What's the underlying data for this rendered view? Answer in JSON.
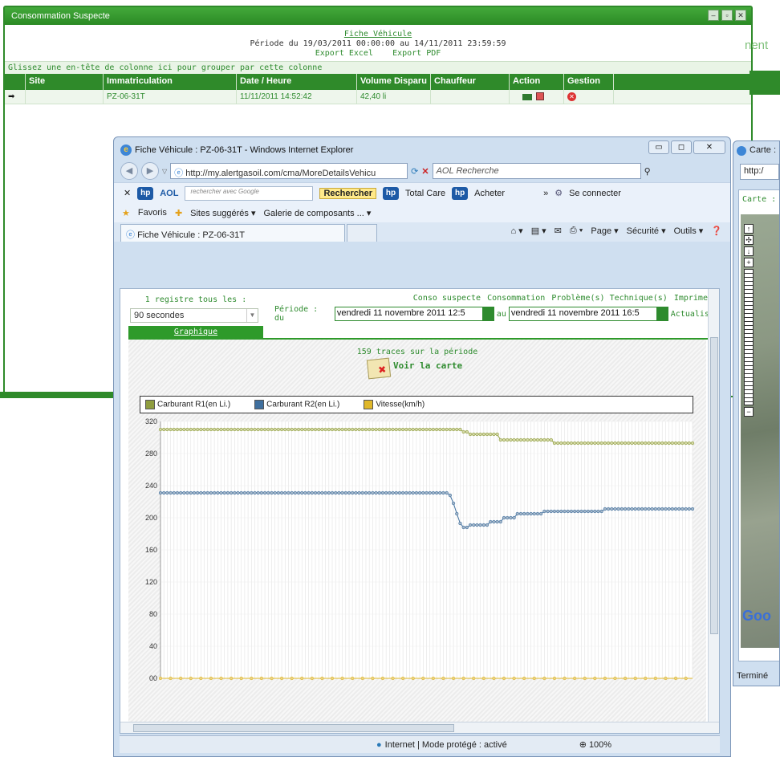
{
  "back_window": {
    "title": "Consommation Suspecte",
    "fiche_link": "Fiche Véhicule",
    "periode_text": "Période du 19/03/2011 00:00:00 au 14/11/2011 23:59:59",
    "export_excel": "Export Excel",
    "export_pdf": "Export PDF",
    "group_hint": "Glissez une en-tête de colonne ici pour grouper par cette colonne",
    "right_fragment": "nent",
    "columns": [
      "Site",
      "Immatriculation",
      "Date / Heure",
      "Volume Disparu",
      "Chauffeur",
      "Action",
      "Gestion"
    ],
    "row": {
      "marker": "➡",
      "site": "",
      "immatriculation": "PZ-06-31T",
      "date_heure": "11/11/2011 14:52:42",
      "volume": "42,40 li",
      "chauffeur": ""
    }
  },
  "ie_window": {
    "title": "Fiche Véhicule : PZ-06-31T - Windows Internet Explorer",
    "address": "http://my.alertgasoil.com/cma/MoreDetailsVehicu",
    "search_placeholder": "AOL Recherche",
    "toolbar": {
      "aol": "AOL",
      "search_with": "rechercher avec Google",
      "rechercher": "Rechercher",
      "total_care": "Total Care",
      "acheter": "Acheter",
      "se_connecter": "Se connecter"
    },
    "favorites": {
      "favoris": "Favoris",
      "sites": "Sites suggérés ▾",
      "galerie": "Galerie de composants ... ▾"
    },
    "tab_label": "Fiche Véhicule : PZ-06-31T",
    "cmd": {
      "page": "Page ▾",
      "securite": "Sécurité ▾",
      "outils": "Outils ▾"
    },
    "status_text": "Internet | Mode protégé : activé",
    "zoom": "100%"
  },
  "content": {
    "menu": [
      "Conso suspecte",
      "Consommation",
      "Problème(s) Technique(s)",
      "Imprimer"
    ],
    "registre_label": "1 registre tous les :",
    "registre_value": "90 secondes",
    "periode_label": "Période : du",
    "date_from": "vendredi 11 novembre 2011 12:5",
    "au": "au",
    "date_to": "vendredi 11 novembre 2011 16:5",
    "actualiser": "Actualiser",
    "graph_tab": "Graphique",
    "traces": "159 traces sur la période",
    "voir_carte": "Voir la carte"
  },
  "map_window": {
    "title": "Carte :",
    "address": "http:/",
    "carte_label": "Carte :",
    "google": "Goo",
    "status": "Terminé"
  },
  "colors": {
    "r1": "#8f9d3f",
    "r2": "#3f6f9e",
    "speed": "#e0b82a",
    "accent_green": "#2e8b2e"
  },
  "chart_data": {
    "type": "line",
    "ylim": [
      0,
      320
    ],
    "yticks": [
      "320",
      "280",
      "240",
      "200",
      "160",
      "120",
      "80",
      "40",
      "00"
    ],
    "legend": [
      "Carburant R1(en Li.)",
      "Carburant R2(en Li.)",
      "Vitesse(km/h)"
    ],
    "n_points": 159,
    "series": [
      {
        "name": "Carburant R1(en Li.)",
        "segments": [
          [
            0,
            90,
            310
          ],
          [
            90,
            92,
            307
          ],
          [
            92,
            101,
            304
          ],
          [
            101,
            117,
            297
          ],
          [
            117,
            159,
            293
          ]
        ]
      },
      {
        "name": "Carburant R2(en Li.)",
        "segments": [
          [
            0,
            86,
            231
          ],
          [
            86,
            87,
            228
          ],
          [
            87,
            88,
            218
          ],
          [
            88,
            89,
            205
          ],
          [
            89,
            90,
            193
          ],
          [
            90,
            92,
            188
          ],
          [
            92,
            98,
            191
          ],
          [
            98,
            102,
            195
          ],
          [
            102,
            106,
            200
          ],
          [
            106,
            114,
            205
          ],
          [
            114,
            132,
            208
          ],
          [
            132,
            159,
            211
          ]
        ]
      },
      {
        "name": "Vitesse(km/h)",
        "values_note": "",
        "segments": [
          [
            0,
            159,
            0
          ]
        ]
      }
    ]
  }
}
